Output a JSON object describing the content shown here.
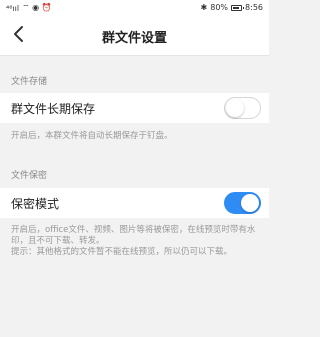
{
  "status_bar": {
    "signal": "⁴⁶ııl",
    "icons_left": "⌔ ◉ ⏰",
    "bluetooth": "✱",
    "battery": "80%",
    "time": "8:56"
  },
  "nav": {
    "title": "群文件设置",
    "back_icon": "chevron-left-icon"
  },
  "sections": {
    "storage": {
      "header": "文件存储",
      "row_label": "群文件长期保存",
      "toggle_state": "off",
      "description": "开启后，本群文件将自动长期保存于钉盘。"
    },
    "secrecy": {
      "header": "文件保密",
      "row_label": "保密模式",
      "toggle_state": "on",
      "description_1": "开启后，office文件、视频、图片等将被保密，在线预览时带有水印，且不可下载、转发。",
      "description_2": "提示：其他格式的文件暂不能在线预览，所以仍可以下载。"
    }
  },
  "colors": {
    "toggle_on": "#2f8cf5",
    "background": "#f2f2f2"
  }
}
